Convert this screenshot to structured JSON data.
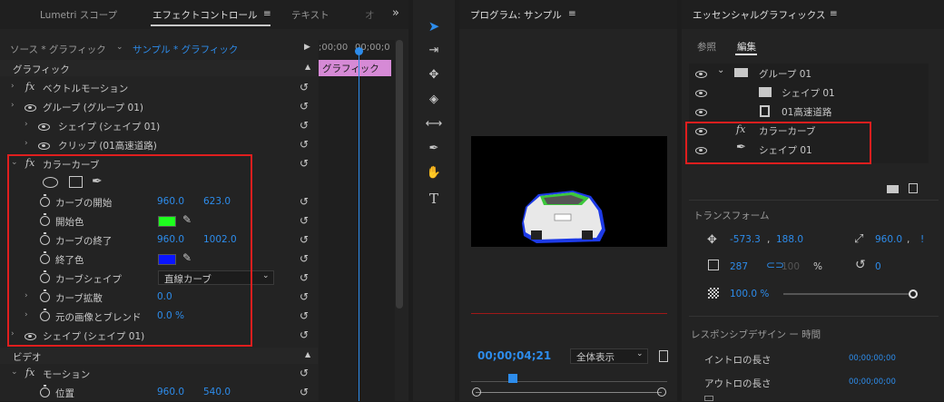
{
  "left_panel": {
    "tabs": [
      "Lumetri スコープ",
      "エフェクトコントロール",
      "テキスト",
      "オ"
    ],
    "source_label": "ソース * グラフィック",
    "sequence_label": "サンプル * グラフィック",
    "timecode_ruler": ";00;00",
    "timecode_ruler2": "00;00;0",
    "clip_label": "グラフィック",
    "section_graphic": "グラフィック",
    "section_video": "ビデオ",
    "rows": {
      "vector_motion": "ベクトルモーション",
      "group": "グループ (グループ 01)",
      "shape": "シェイプ (シェイプ 01)",
      "clip": "クリップ (01高速道路)",
      "color_curve": "カラーカーブ",
      "curve_start": "カーブの開始",
      "curve_start_x": "960.0",
      "curve_start_y": "623.0",
      "start_color": "開始色",
      "curve_end": "カーブの終了",
      "curve_end_x": "960.0",
      "curve_end_y": "1002.0",
      "end_color": "終了色",
      "curve_shape": "カーブシェイプ",
      "curve_shape_value": "直線カーブ",
      "curve_spread": "カーブ拡散",
      "curve_spread_value": "0.0",
      "blend": "元の画像とブレンド",
      "blend_value": "0.0 %",
      "shape2": "シェイプ (シェイプ 01)",
      "motion": "モーション",
      "position": "位置",
      "position_x": "960.0",
      "position_y": "540.0"
    },
    "start_color_hex": "#1eff1e",
    "end_color_hex": "#0a14ff"
  },
  "tools": [
    "selection-tool",
    "track-select-tool",
    "ripple-edit-tool",
    "razor-tool",
    "slip-tool",
    "pen-tool",
    "hand-tool",
    "type-tool"
  ],
  "program": {
    "title": "プログラム: サンプル",
    "timecode": "00;00;04;21",
    "zoom": "全体表示"
  },
  "essential": {
    "title": "エッセンシャルグラフィックス",
    "tab_browse": "参照",
    "tab_edit": "編集",
    "layers": {
      "group": "グループ 01",
      "shape": "シェイプ 01",
      "clip": "01高速道路",
      "color_curve": "カラーカーブ",
      "shape2": "シェイプ 01"
    },
    "transform_title": "トランスフォーム",
    "pos_x": "-573.3",
    "pos_y": "188.0",
    "anchor_x": "960.0",
    "anchor_y": "!",
    "scale": "287",
    "scale2": "100",
    "scale_unit": "%",
    "rotation": "0",
    "opacity": "100.0 %",
    "responsive_title": "レスポンシブデザイン ー 時間",
    "intro_label": "イントロの長さ",
    "intro_value": "00;00;00;00",
    "outro_label": "アウトロの長さ",
    "outro_value": "00;00;00;00"
  }
}
